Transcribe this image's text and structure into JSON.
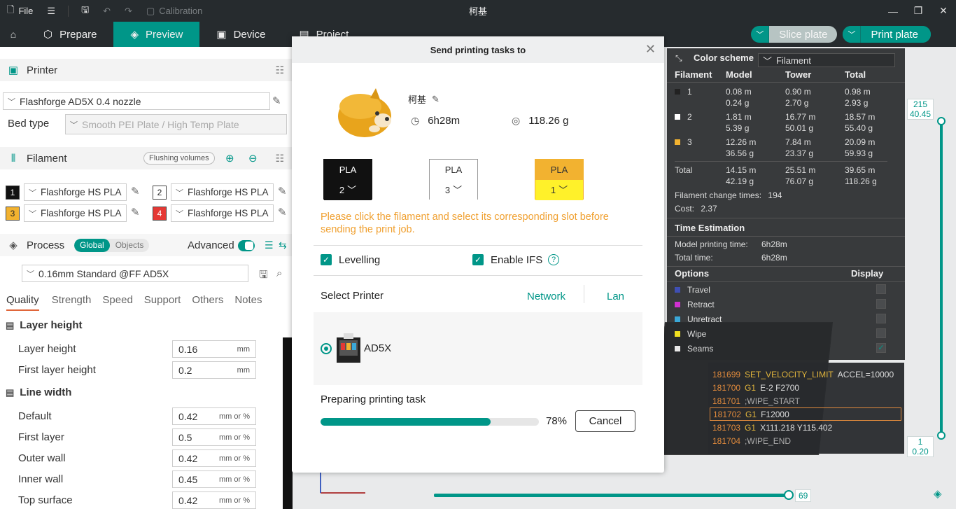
{
  "titlebar": {
    "file_label": "File",
    "calibration_label": "Calibration",
    "window_title": "柯基"
  },
  "nav": {
    "tabs": [
      {
        "label": "Prepare"
      },
      {
        "label": "Preview"
      },
      {
        "label": "Device"
      },
      {
        "label": "Project"
      }
    ],
    "active_tab": "Preview",
    "slice_plate_label": "Slice plate",
    "print_plate_label": "Print plate"
  },
  "sidebar": {
    "printer_title": "Printer",
    "printer_preset": "Flashforge AD5X 0.4 nozzle",
    "bed_type_label": "Bed type",
    "bed_type_value": "Smooth PEI Plate / High Temp Plate",
    "filament_title": "Filament",
    "flushing_volumes_label": "Flushing volumes",
    "filaments": [
      {
        "slot": "1",
        "color": "#111111",
        "text_color": "#ffffff",
        "name": "Flashforge HS PLA"
      },
      {
        "slot": "2",
        "color": "#ffffff",
        "text_color": "#222222",
        "name": "Flashforge HS PLA"
      },
      {
        "slot": "3",
        "color": "#f2b230",
        "text_color": "#222222",
        "name": "Flashforge HS PLA"
      },
      {
        "slot": "4",
        "color": "#e53935",
        "text_color": "#ffffff",
        "name": "Flashforge HS PLA"
      }
    ],
    "process_title": "Process",
    "global_label": "Global",
    "objects_label": "Objects",
    "advanced_label": "Advanced",
    "process_preset": "0.16mm Standard @FF AD5X",
    "tabs": [
      "Quality",
      "Strength",
      "Speed",
      "Support",
      "Others",
      "Notes"
    ],
    "group_layer_height": "Layer height",
    "group_line_width": "Line width",
    "params": [
      {
        "label": "Layer height",
        "value": "0.16",
        "unit": "mm"
      },
      {
        "label": "First layer height",
        "value": "0.2",
        "unit": "mm"
      },
      {
        "label": "Default",
        "value": "0.42",
        "unit": "mm or %"
      },
      {
        "label": "First layer",
        "value": "0.5",
        "unit": "mm or %"
      },
      {
        "label": "Outer wall",
        "value": "0.42",
        "unit": "mm or %"
      },
      {
        "label": "Inner wall",
        "value": "0.45",
        "unit": "mm or %"
      },
      {
        "label": "Top surface",
        "value": "0.42",
        "unit": "mm or %"
      }
    ]
  },
  "color_scheme": {
    "title": "Color scheme",
    "selected": "Filament",
    "headers": [
      "Filament",
      "Model",
      "Tower",
      "Total"
    ],
    "rows": [
      {
        "id": "1",
        "swatch": "#222222",
        "model": [
          "0.08 m",
          "0.24 g"
        ],
        "tower": [
          "0.90 m",
          "2.70 g"
        ],
        "total": [
          "0.98 m",
          "2.93 g"
        ]
      },
      {
        "id": "2",
        "swatch": "#ffffff",
        "model": [
          "1.81 m",
          "5.39 g"
        ],
        "tower": [
          "16.77 m",
          "50.01 g"
        ],
        "total": [
          "18.57 m",
          "55.40 g"
        ]
      },
      {
        "id": "3",
        "swatch": "#f2b230",
        "model": [
          "12.26 m",
          "36.56 g"
        ],
        "tower": [
          "7.84 m",
          "23.37 g"
        ],
        "total": [
          "20.09 m",
          "59.93 g"
        ]
      }
    ],
    "total_label": "Total",
    "total": {
      "model": [
        "14.15 m",
        "42.19 g"
      ],
      "tower": [
        "25.51 m",
        "76.07 g"
      ],
      "total": [
        "39.65 m",
        "118.26 g"
      ]
    },
    "change_times_label": "Filament change times:",
    "change_times_value": "194",
    "cost_label": "Cost:",
    "cost_value": "2.37",
    "time_estimation_title": "Time Estimation",
    "model_time_label": "Model printing time:",
    "model_time_value": "6h28m",
    "total_time_label": "Total time:",
    "total_time_value": "6h28m",
    "options_title": "Options",
    "display_title": "Display",
    "options": [
      {
        "label": "Travel",
        "color": "#3f4fb3",
        "checked": false
      },
      {
        "label": "Retract",
        "color": "#d030d0",
        "checked": false
      },
      {
        "label": "Unretract",
        "color": "#3aa8d8",
        "checked": false
      },
      {
        "label": "Wipe",
        "color": "#f0e020",
        "checked": false
      },
      {
        "label": "Seams",
        "color": "#e8e8e8",
        "checked": true
      }
    ]
  },
  "gcode": [
    {
      "num": "181699",
      "kw": "SET_VELOCITY_LIMIT",
      "rest": "ACCEL=10000",
      "comment": false
    },
    {
      "num": "181700",
      "kw": "G1",
      "rest": "E-2 F2700",
      "comment": false
    },
    {
      "num": "181701",
      "kw": "",
      "rest": ";WIPE_START",
      "comment": true
    },
    {
      "num": "181702",
      "kw": "G1",
      "rest": "F12000",
      "comment": false
    },
    {
      "num": "181703",
      "kw": "G1",
      "rest": "X111.218 Y115.402",
      "comment": false
    },
    {
      "num": "181704",
      "kw": "",
      "rest": ";WIPE_END",
      "comment": true
    }
  ],
  "layer_slider": {
    "top_layer": "215",
    "top_height": "40.45",
    "bottom_layer": "1",
    "bottom_height": "0.20"
  },
  "move_slider": {
    "value": "69"
  },
  "modal": {
    "title": "Send printing tasks to",
    "model_name": "柯基",
    "print_time": "6h28m",
    "weight": "118.26 g",
    "filament_slots": [
      {
        "type": "PLA",
        "slot": "2",
        "bg": "#111111",
        "fg": "#ffffff",
        "bottom_bg": "#111111"
      },
      {
        "type": "PLA",
        "slot": "3",
        "bg": "#ffffff",
        "fg": "#333333",
        "bottom_bg": "#ffffff"
      },
      {
        "type": "PLA",
        "slot": "1",
        "bg": "#f2b230",
        "fg": "#333333",
        "bottom_bg": "#fff12a"
      }
    ],
    "warning": "Please click the filament and select its corresponding slot before sending the print job.",
    "levelling_label": "Levelling",
    "enable_ifs_label": "Enable IFS",
    "select_printer_label": "Select Printer",
    "network_label": "Network",
    "lan_label": "Lan",
    "printer_name": "AD5X",
    "progress_label": "Preparing printing task",
    "progress_percent": 78,
    "progress_text": "78%",
    "cancel_label": "Cancel"
  }
}
